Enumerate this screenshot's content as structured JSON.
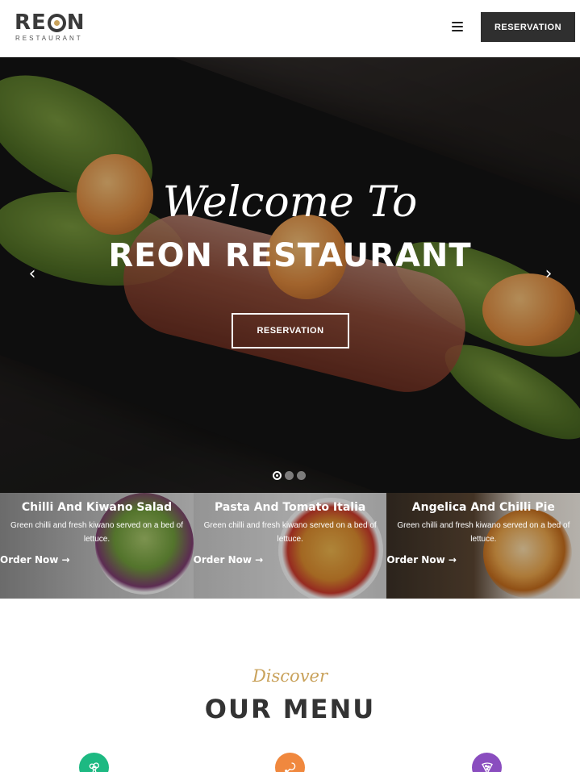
{
  "header": {
    "logo_text": "REON",
    "logo_sub": "RESTAURANT",
    "reservation_label": "RESERVATION"
  },
  "hero": {
    "script_text": "Welcome To",
    "title": "REON RESTAURANT",
    "button_label": "RESERVATION",
    "slides": 3,
    "active_slide": 1
  },
  "cards": [
    {
      "title": "Chilli And Kiwano Salad",
      "description": "Green chilli and fresh kiwano served on a bed of lettuce.",
      "link": "Order Now →"
    },
    {
      "title": "Pasta And Tomato Italia",
      "description": "Green chilli and fresh kiwano served on a bed of lettuce.",
      "link": "Order Now →"
    },
    {
      "title": "Angelica And Chilli Pie",
      "description": "Green chilli and fresh kiwano served on a bed of lettuce.",
      "link": "Order Now →"
    }
  ],
  "menu_section": {
    "script": "Discover",
    "title": "OUR MENU",
    "categories": [
      {
        "icon": "broccoli-icon",
        "color": "#1db982"
      },
      {
        "icon": "chicken-leg-icon",
        "color": "#f0883e"
      },
      {
        "icon": "pizza-icon",
        "color": "#8a4dbf"
      }
    ]
  },
  "colors": {
    "accent_gold": "#c9a25b",
    "dark_button": "#2f2f2f"
  }
}
